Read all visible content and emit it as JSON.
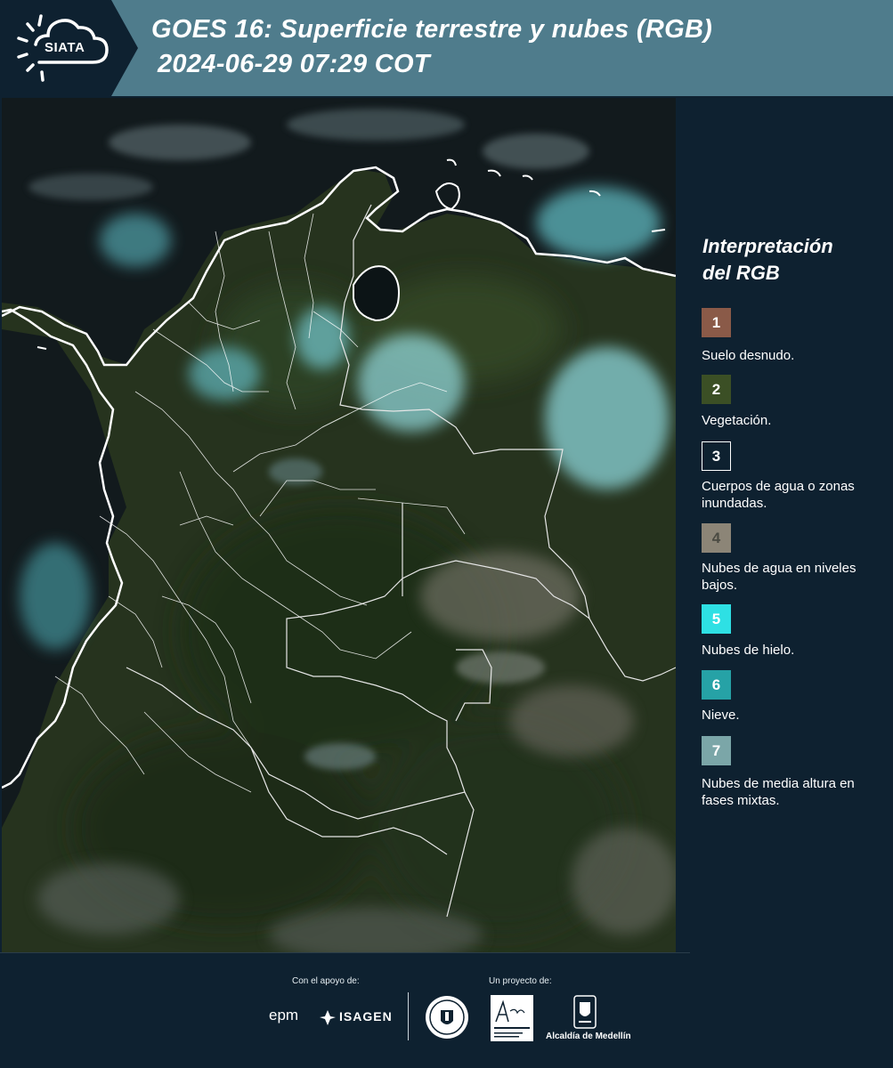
{
  "header": {
    "logo_text": "SIATA",
    "title_line1": "GOES 16: Superficie terrestre y nubes (RGB)",
    "title_line2": "2024-06-29 07:29 COT"
  },
  "legend": {
    "title_line1": "Interpretación",
    "title_line2": "del RGB",
    "items": [
      {
        "number": "1",
        "label": "Suelo desnudo.",
        "color": "#8a5a48"
      },
      {
        "number": "2",
        "label": "Vegetación.",
        "color": "#3b4f25"
      },
      {
        "number": "3",
        "label": "Cuerpos de agua o zonas inundadas.",
        "color": "#0e2130"
      },
      {
        "number": "4",
        "label": "Nubes de agua en niveles bajos.",
        "color": "#8c8577"
      },
      {
        "number": "5",
        "label": "Nubes de hielo.",
        "color": "#2ee0e4"
      },
      {
        "number": "6",
        "label": "Nieve.",
        "color": "#26a2a6"
      },
      {
        "number": "7",
        "label": "Nubes de media altura en fases mixtas.",
        "color": "#7ba6a8"
      }
    ]
  },
  "footer": {
    "support_label": "Con el apoyo de:",
    "project_label": "Un proyecto de:",
    "sponsor_epm": "epm",
    "sponsor_isagen": "ISAGEN",
    "area_script": "Área",
    "area_line1": "METROPOLITANA",
    "area_line2": "Valle de Aburrá",
    "alcaldia": "Alcaldía de Medellín"
  },
  "colors": {
    "header_bg": "#4f7c8c",
    "page_bg": "#0e2130",
    "vegetation": "#2c3d1f",
    "ice_cloud": "#7fd6db"
  }
}
